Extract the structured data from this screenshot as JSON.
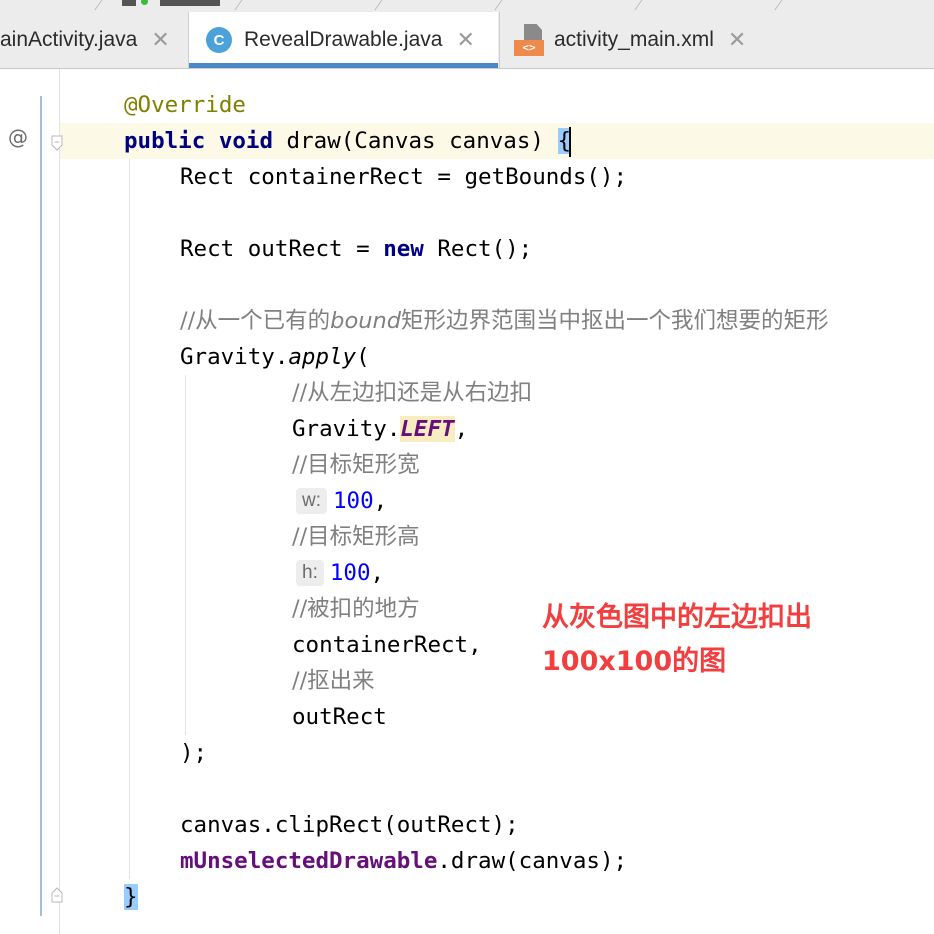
{
  "tabs": [
    {
      "label": "ainActivity.java",
      "icon": "java-class-icon",
      "active": false
    },
    {
      "label": "RevealDrawable.java",
      "icon": "java-class-icon",
      "active": true
    },
    {
      "label": "activity_main.xml",
      "icon": "xml-layout-icon",
      "active": false
    }
  ],
  "tab_close_glyph": "✕",
  "java_icon_letter": "C",
  "xml_icon_badge": "<>",
  "gutter": {
    "override_marker": "@"
  },
  "code": {
    "l1": {
      "annotation": "@Override"
    },
    "l2": {
      "kw_public": "public",
      "kw_void": "void",
      "signature": " draw(Canvas canvas) ",
      "brace": "{"
    },
    "l3": {
      "text": "Rect containerRect = getBounds();"
    },
    "l5": {
      "pre": "Rect outRect = ",
      "kw_new": "new",
      "post": " Rect();"
    },
    "l7": {
      "c1": "//从一个已有的",
      "c_italic": "bound",
      "c2": "矩形边界范围当中抠出一个我们想要的矩形"
    },
    "l8": {
      "cls": "Gravity.",
      "method": "apply",
      "paren": "("
    },
    "l9": {
      "comment": "//从左边扣还是从右边扣"
    },
    "l10": {
      "cls": "Gravity.",
      "field": "LEFT",
      "comma": ","
    },
    "l11": {
      "comment": "//目标矩形宽"
    },
    "l12": {
      "hint": "w:",
      "value": "100",
      "comma": ","
    },
    "l13": {
      "comment": "//目标矩形高"
    },
    "l14": {
      "hint": "h:",
      "value": "100",
      "comma": ","
    },
    "l15": {
      "comment": "//被扣的地方"
    },
    "l16": {
      "text": "containerRect,"
    },
    "l17": {
      "comment": "//抠出来"
    },
    "l18": {
      "text": "outRect"
    },
    "l19": {
      "text": ");"
    },
    "l21": {
      "text": "canvas.clipRect(outRect);"
    },
    "l22": {
      "field": "mUnselectedDrawable",
      "post": ".draw(canvas);"
    },
    "l23": {
      "brace": "}"
    }
  },
  "annotation_note": {
    "line1": "从灰色图中的左边扣出",
    "line2": "100x100的图",
    "color": "#f23e3e"
  },
  "colors": {
    "accent_tab": "#4a88c7",
    "caret_line": "#fcfae6",
    "keyword": "#000080",
    "annotation": "#808000",
    "number": "#0000ff",
    "field": "#660e7a",
    "comment": "#808080"
  }
}
